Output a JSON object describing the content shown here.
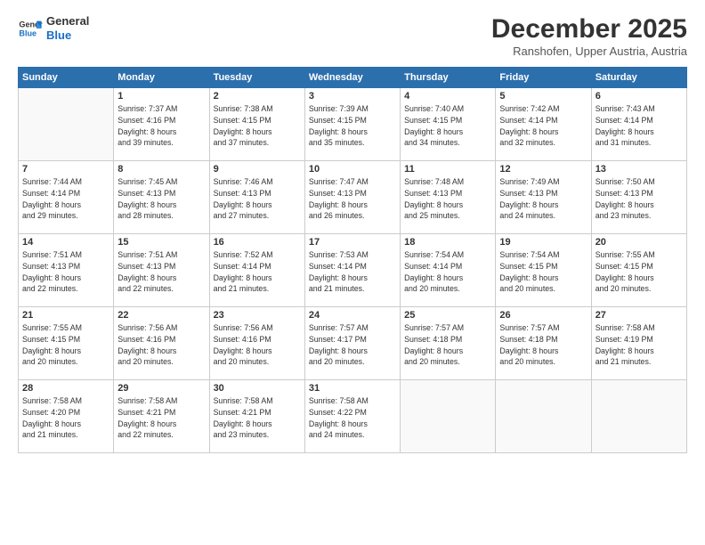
{
  "logo": {
    "line1": "General",
    "line2": "Blue"
  },
  "title": "December 2025",
  "subtitle": "Ranshofen, Upper Austria, Austria",
  "days_of_week": [
    "Sunday",
    "Monday",
    "Tuesday",
    "Wednesday",
    "Thursday",
    "Friday",
    "Saturday"
  ],
  "weeks": [
    [
      {
        "day": "",
        "info": ""
      },
      {
        "day": "1",
        "info": "Sunrise: 7:37 AM\nSunset: 4:16 PM\nDaylight: 8 hours\nand 39 minutes."
      },
      {
        "day": "2",
        "info": "Sunrise: 7:38 AM\nSunset: 4:15 PM\nDaylight: 8 hours\nand 37 minutes."
      },
      {
        "day": "3",
        "info": "Sunrise: 7:39 AM\nSunset: 4:15 PM\nDaylight: 8 hours\nand 35 minutes."
      },
      {
        "day": "4",
        "info": "Sunrise: 7:40 AM\nSunset: 4:15 PM\nDaylight: 8 hours\nand 34 minutes."
      },
      {
        "day": "5",
        "info": "Sunrise: 7:42 AM\nSunset: 4:14 PM\nDaylight: 8 hours\nand 32 minutes."
      },
      {
        "day": "6",
        "info": "Sunrise: 7:43 AM\nSunset: 4:14 PM\nDaylight: 8 hours\nand 31 minutes."
      }
    ],
    [
      {
        "day": "7",
        "info": "Sunrise: 7:44 AM\nSunset: 4:14 PM\nDaylight: 8 hours\nand 29 minutes."
      },
      {
        "day": "8",
        "info": "Sunrise: 7:45 AM\nSunset: 4:13 PM\nDaylight: 8 hours\nand 28 minutes."
      },
      {
        "day": "9",
        "info": "Sunrise: 7:46 AM\nSunset: 4:13 PM\nDaylight: 8 hours\nand 27 minutes."
      },
      {
        "day": "10",
        "info": "Sunrise: 7:47 AM\nSunset: 4:13 PM\nDaylight: 8 hours\nand 26 minutes."
      },
      {
        "day": "11",
        "info": "Sunrise: 7:48 AM\nSunset: 4:13 PM\nDaylight: 8 hours\nand 25 minutes."
      },
      {
        "day": "12",
        "info": "Sunrise: 7:49 AM\nSunset: 4:13 PM\nDaylight: 8 hours\nand 24 minutes."
      },
      {
        "day": "13",
        "info": "Sunrise: 7:50 AM\nSunset: 4:13 PM\nDaylight: 8 hours\nand 23 minutes."
      }
    ],
    [
      {
        "day": "14",
        "info": "Sunrise: 7:51 AM\nSunset: 4:13 PM\nDaylight: 8 hours\nand 22 minutes."
      },
      {
        "day": "15",
        "info": "Sunrise: 7:51 AM\nSunset: 4:13 PM\nDaylight: 8 hours\nand 22 minutes."
      },
      {
        "day": "16",
        "info": "Sunrise: 7:52 AM\nSunset: 4:14 PM\nDaylight: 8 hours\nand 21 minutes."
      },
      {
        "day": "17",
        "info": "Sunrise: 7:53 AM\nSunset: 4:14 PM\nDaylight: 8 hours\nand 21 minutes."
      },
      {
        "day": "18",
        "info": "Sunrise: 7:54 AM\nSunset: 4:14 PM\nDaylight: 8 hours\nand 20 minutes."
      },
      {
        "day": "19",
        "info": "Sunrise: 7:54 AM\nSunset: 4:15 PM\nDaylight: 8 hours\nand 20 minutes."
      },
      {
        "day": "20",
        "info": "Sunrise: 7:55 AM\nSunset: 4:15 PM\nDaylight: 8 hours\nand 20 minutes."
      }
    ],
    [
      {
        "day": "21",
        "info": "Sunrise: 7:55 AM\nSunset: 4:15 PM\nDaylight: 8 hours\nand 20 minutes."
      },
      {
        "day": "22",
        "info": "Sunrise: 7:56 AM\nSunset: 4:16 PM\nDaylight: 8 hours\nand 20 minutes."
      },
      {
        "day": "23",
        "info": "Sunrise: 7:56 AM\nSunset: 4:16 PM\nDaylight: 8 hours\nand 20 minutes."
      },
      {
        "day": "24",
        "info": "Sunrise: 7:57 AM\nSunset: 4:17 PM\nDaylight: 8 hours\nand 20 minutes."
      },
      {
        "day": "25",
        "info": "Sunrise: 7:57 AM\nSunset: 4:18 PM\nDaylight: 8 hours\nand 20 minutes."
      },
      {
        "day": "26",
        "info": "Sunrise: 7:57 AM\nSunset: 4:18 PM\nDaylight: 8 hours\nand 20 minutes."
      },
      {
        "day": "27",
        "info": "Sunrise: 7:58 AM\nSunset: 4:19 PM\nDaylight: 8 hours\nand 21 minutes."
      }
    ],
    [
      {
        "day": "28",
        "info": "Sunrise: 7:58 AM\nSunset: 4:20 PM\nDaylight: 8 hours\nand 21 minutes."
      },
      {
        "day": "29",
        "info": "Sunrise: 7:58 AM\nSunset: 4:21 PM\nDaylight: 8 hours\nand 22 minutes."
      },
      {
        "day": "30",
        "info": "Sunrise: 7:58 AM\nSunset: 4:21 PM\nDaylight: 8 hours\nand 23 minutes."
      },
      {
        "day": "31",
        "info": "Sunrise: 7:58 AM\nSunset: 4:22 PM\nDaylight: 8 hours\nand 24 minutes."
      },
      {
        "day": "",
        "info": ""
      },
      {
        "day": "",
        "info": ""
      },
      {
        "day": "",
        "info": ""
      }
    ]
  ]
}
